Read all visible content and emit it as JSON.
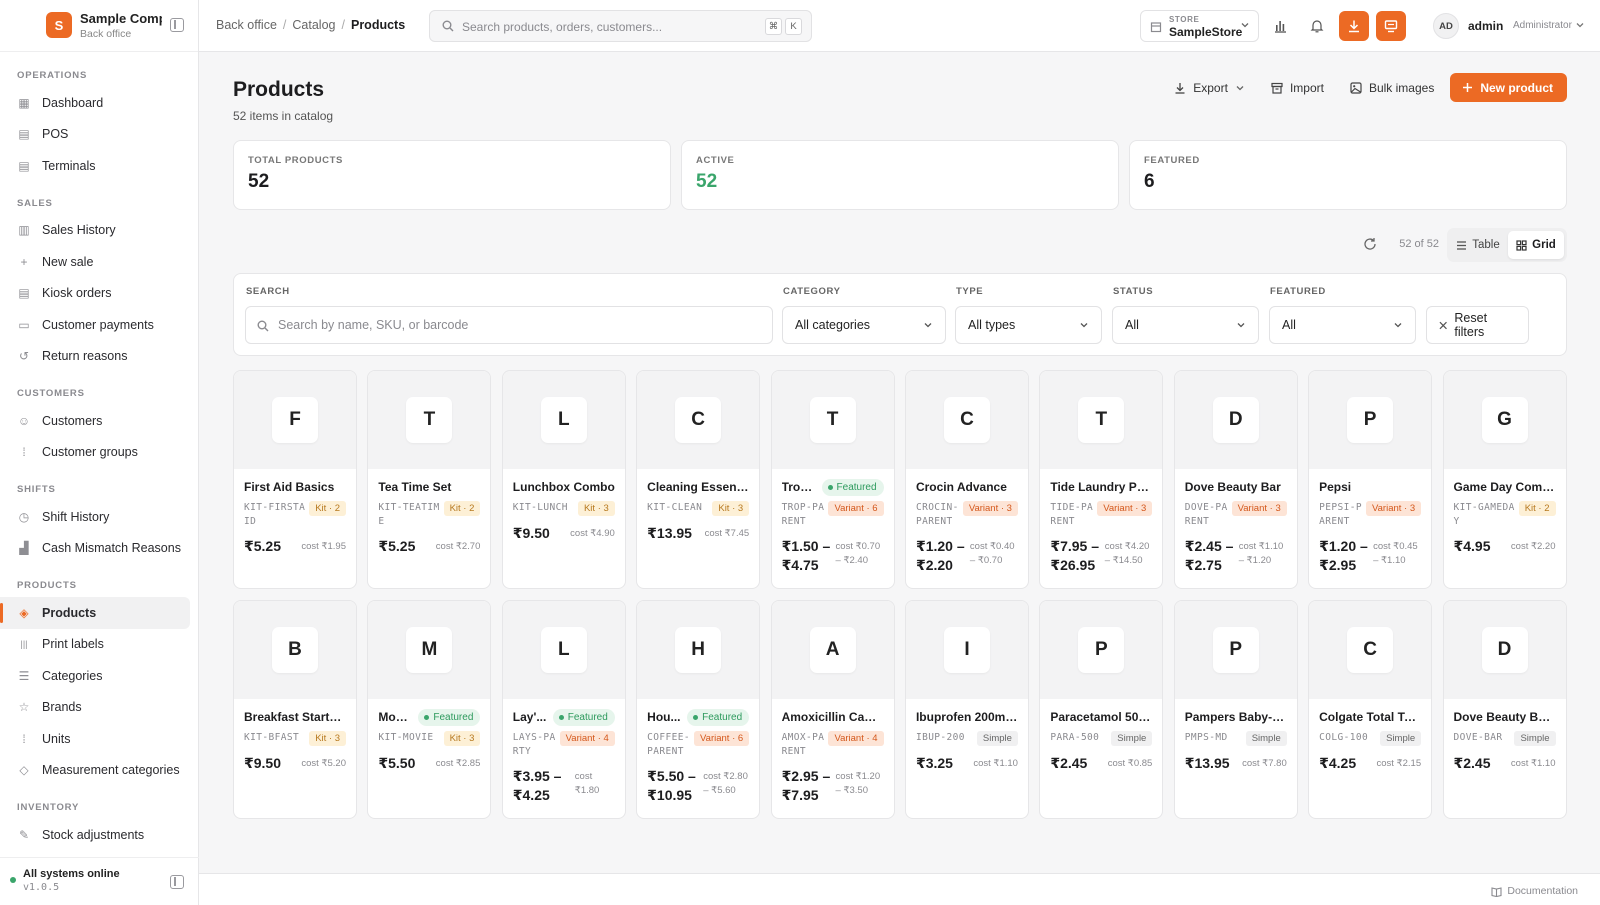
{
  "brand": {
    "initial": "S",
    "name": "Sample Company",
    "subtitle": "Back office"
  },
  "nav": [
    {
      "section": "Operations",
      "items": [
        {
          "label": "Dashboard",
          "icon": "dashboard-icon",
          "glyph": "▦"
        },
        {
          "label": "POS",
          "icon": "pos-icon",
          "glyph": "▤"
        },
        {
          "label": "Terminals",
          "icon": "terminal-icon",
          "glyph": "▤"
        }
      ]
    },
    {
      "section": "Sales",
      "items": [
        {
          "label": "Sales History",
          "icon": "receipt-icon",
          "glyph": "▥"
        },
        {
          "label": "New sale",
          "icon": "plus-icon",
          "glyph": "+"
        },
        {
          "label": "Kiosk orders",
          "icon": "kiosk-icon",
          "glyph": "▤"
        },
        {
          "label": "Customer payments",
          "icon": "banknote-icon",
          "glyph": "▭"
        },
        {
          "label": "Return reasons",
          "icon": "undo-icon",
          "glyph": "↺"
        }
      ]
    },
    {
      "section": "Customers",
      "items": [
        {
          "label": "Customers",
          "icon": "users-icon",
          "glyph": "☺"
        },
        {
          "label": "Customer groups",
          "icon": "grip-icon",
          "glyph": "⁞"
        }
      ]
    },
    {
      "section": "Shifts",
      "items": [
        {
          "label": "Shift History",
          "icon": "clock-icon",
          "glyph": "◷"
        },
        {
          "label": "Cash Mismatch Reasons",
          "icon": "bar-chart-icon",
          "glyph": "▟"
        }
      ]
    },
    {
      "section": "Products",
      "items": [
        {
          "label": "Products",
          "icon": "package-icon",
          "glyph": "◈",
          "active": true
        },
        {
          "label": "Print labels",
          "icon": "barcode-icon",
          "glyph": "|||"
        },
        {
          "label": "Categories",
          "icon": "list-tree-icon",
          "glyph": "☰"
        },
        {
          "label": "Brands",
          "icon": "star-icon",
          "glyph": "☆"
        },
        {
          "label": "Units",
          "icon": "grip-icon",
          "glyph": "⁞"
        },
        {
          "label": "Measurement categories",
          "icon": "tag-icon",
          "glyph": "◇"
        }
      ]
    },
    {
      "section": "Inventory",
      "items": [
        {
          "label": "Stock adjustments",
          "icon": "edit-icon",
          "glyph": "✎"
        }
      ]
    }
  ],
  "footer": {
    "status": "All systems online",
    "version": "v1.0.5",
    "docs": "Documentation"
  },
  "topbar": {
    "crumbs": [
      "Back office",
      "Catalog",
      "Products"
    ],
    "search_placeholder": "Search products, orders, customers...",
    "kbd": [
      "⌘",
      "K"
    ],
    "store_label": "STORE",
    "store_value": "SampleStore",
    "user_initials": "AD",
    "user_name": "admin",
    "user_role": "Administrator"
  },
  "page": {
    "title": "Products",
    "subtitle": "52 items in catalog",
    "export": "Export",
    "import": "Import",
    "bulk": "Bulk images",
    "new": "New product"
  },
  "stats": [
    {
      "label": "Total products",
      "value": "52"
    },
    {
      "label": "Active",
      "value": "52"
    },
    {
      "label": "Featured",
      "value": "6"
    }
  ],
  "view": {
    "count": "52 of 52",
    "table": "Table",
    "grid": "Grid"
  },
  "filters": {
    "search_label": "Search",
    "search_placeholder": "Search by name, SKU, or barcode",
    "category_label": "Category",
    "category_value": "All categories",
    "type_label": "Type",
    "type_value": "All types",
    "status_label": "Status",
    "status_value": "All",
    "featured_label": "Featured",
    "featured_value": "All",
    "reset": "Reset filters"
  },
  "accent": "#ec6a24",
  "products": [
    {
      "letter": "F",
      "name": "First Aid Basics",
      "sku": "KIT-FIRSTAID",
      "tag": "Kit · 2",
      "tagType": "kit",
      "price": "₹5.25",
      "cost": "cost ₹1.95"
    },
    {
      "letter": "T",
      "name": "Tea Time Set",
      "sku": "KIT-TEATIME",
      "tag": "Kit · 2",
      "tagType": "kit",
      "price": "₹5.25",
      "cost": "cost ₹2.70"
    },
    {
      "letter": "L",
      "name": "Lunchbox Combo",
      "sku": "KIT-LUNCH",
      "tag": "Kit · 3",
      "tagType": "kit",
      "price": "₹9.50",
      "cost": "cost ₹4.90"
    },
    {
      "letter": "C",
      "name": "Cleaning Essentials",
      "sku": "KIT-CLEAN",
      "tag": "Kit · 3",
      "tagType": "kit",
      "price": "₹13.95",
      "cost": "cost ₹7.45"
    },
    {
      "letter": "T",
      "name": "Trop...",
      "featured": "Featured",
      "sku": "TROP-PARENT",
      "tag": "Variant · 6",
      "tagType": "variant",
      "price": "₹1.50 – ₹4.75",
      "cost": "cost ₹0.70 – ₹2.40"
    },
    {
      "letter": "C",
      "name": "Crocin Advance",
      "sku": "CROCIN-PARENT",
      "tag": "Variant · 3",
      "tagType": "variant",
      "price": "₹1.20 – ₹2.20",
      "cost": "cost ₹0.40 – ₹0.70"
    },
    {
      "letter": "T",
      "name": "Tide Laundry Pow...",
      "sku": "TIDE-PARENT",
      "tag": "Variant · 3",
      "tagType": "variant",
      "price": "₹7.95 – ₹26.95",
      "cost": "cost ₹4.20 – ₹14.50"
    },
    {
      "letter": "D",
      "name": "Dove Beauty Bar",
      "sku": "DOVE-PARENT",
      "tag": "Variant · 3",
      "tagType": "variant",
      "price": "₹2.45 – ₹2.75",
      "cost": "cost ₹1.10 – ₹1.20"
    },
    {
      "letter": "P",
      "name": "Pepsi",
      "sku": "PEPSI-PARENT",
      "tag": "Variant · 3",
      "tagType": "variant",
      "price": "₹1.20 – ₹2.95",
      "cost": "cost ₹0.45 – ₹1.10"
    },
    {
      "letter": "G",
      "name": "Game Day Combo",
      "sku": "KIT-GAMEDAY",
      "tag": "Kit · 2",
      "tagType": "kit",
      "price": "₹4.95",
      "cost": "cost ₹2.20"
    },
    {
      "letter": "B",
      "name": "Breakfast Starter ...",
      "sku": "KIT-BFAST",
      "tag": "Kit · 3",
      "tagType": "kit",
      "price": "₹9.50",
      "cost": "cost ₹5.20"
    },
    {
      "letter": "M",
      "name": "Movi...",
      "featured": "Featured",
      "sku": "KIT-MOVIE",
      "tag": "Kit · 3",
      "tagType": "kit",
      "price": "₹5.50",
      "cost": "cost ₹2.85"
    },
    {
      "letter": "L",
      "name": "Lay'...",
      "featured": "Featured",
      "sku": "LAYS-PARTY",
      "tag": "Variant · 4",
      "tagType": "variant",
      "price": "₹3.95 – ₹4.25",
      "cost": "cost ₹1.80"
    },
    {
      "letter": "H",
      "name": "Hou...",
      "featured": "Featured",
      "sku": "COFFEE-PARENT",
      "tag": "Variant · 6",
      "tagType": "variant",
      "price": "₹5.50 – ₹10.95",
      "cost": "cost ₹2.80 – ₹5.60"
    },
    {
      "letter": "A",
      "name": "Amoxicillin Capsu...",
      "sku": "AMOX-PARENT",
      "tag": "Variant · 4",
      "tagType": "variant",
      "price": "₹2.95 – ₹7.95",
      "cost": "cost ₹1.20 – ₹3.50"
    },
    {
      "letter": "I",
      "name": "Ibuprofen 200mg...",
      "sku": "IBUP-200",
      "tag": "Simple",
      "tagType": "simple",
      "price": "₹3.25",
      "cost": "cost ₹1.10"
    },
    {
      "letter": "P",
      "name": "Paracetamol 500...",
      "sku": "PARA-500",
      "tag": "Simple",
      "tagType": "simple",
      "price": "₹2.45",
      "cost": "cost ₹0.85"
    },
    {
      "letter": "P",
      "name": "Pampers Baby-Dr...",
      "sku": "PMPS-MD",
      "tag": "Simple",
      "tagType": "simple",
      "price": "₹13.95",
      "cost": "cost ₹7.80"
    },
    {
      "letter": "C",
      "name": "Colgate Total Too...",
      "sku": "COLG-100",
      "tag": "Simple",
      "tagType": "simple",
      "price": "₹4.25",
      "cost": "cost ₹2.15"
    },
    {
      "letter": "D",
      "name": "Dove Beauty Bar ...",
      "sku": "DOVE-BAR",
      "tag": "Simple",
      "tagType": "simple",
      "price": "₹2.45",
      "cost": "cost ₹1.10"
    }
  ]
}
